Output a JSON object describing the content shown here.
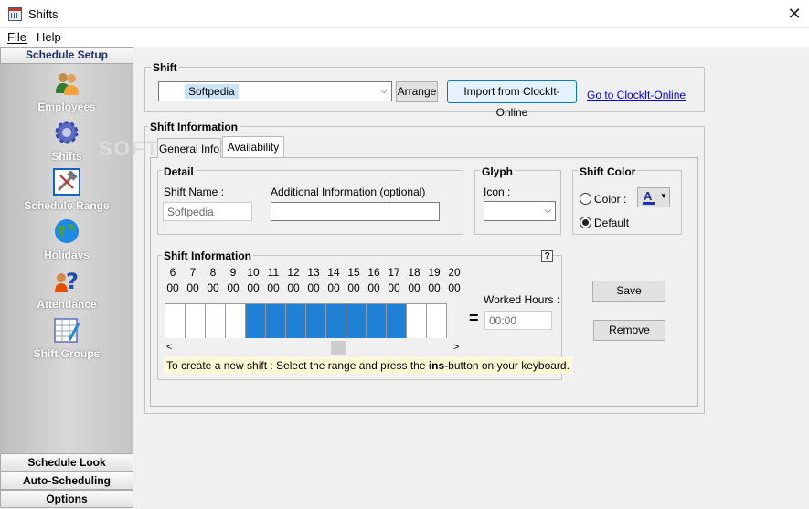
{
  "window": {
    "title": "Shifts"
  },
  "menu": {
    "file": "File",
    "help": "Help"
  },
  "sidebar": {
    "header": "Schedule Setup",
    "items": [
      {
        "label": "Employees",
        "icon": "employees-icon"
      },
      {
        "label": "Shifts",
        "icon": "gear-icon"
      },
      {
        "label": "Schedule Range",
        "icon": "tools-icon"
      },
      {
        "label": "Holidays",
        "icon": "globe-icon"
      },
      {
        "label": "Attendance",
        "icon": "question-icon"
      },
      {
        "label": "Shift Groups",
        "icon": "calculator-icon"
      }
    ],
    "footer": [
      "Schedule Look",
      "Auto-Scheduling",
      "Options"
    ]
  },
  "watermark": "SOFTPEDIA",
  "shift": {
    "group_title": "Shift",
    "selected": "Softpedia",
    "arrange_label": "Arrange",
    "import_label": "Import from ClockIt-Online",
    "goto_link": "Go to ClockIt-Online"
  },
  "info": {
    "group_title": "Shift Information",
    "tabs": [
      "General Info",
      "Availability"
    ],
    "detail": {
      "title": "Detail",
      "shift_name_label": "Shift Name :",
      "shift_name_value": "Softpedia",
      "additional_label": "Additional Information (optional)",
      "additional_value": ""
    },
    "glyph": {
      "title": "Glyph",
      "icon_label": "Icon :"
    },
    "color": {
      "title": "Shift Color",
      "color_label": "Color :",
      "default_label": "Default",
      "selected": "default"
    },
    "timeline": {
      "title": "Shift Information",
      "help": "?",
      "hours": [
        "6",
        "7",
        "8",
        "9",
        "10",
        "11",
        "12",
        "13",
        "14",
        "15",
        "16",
        "17",
        "18",
        "19",
        "20"
      ],
      "minutes": "00",
      "selected_start": "10",
      "selected_end": "18",
      "equals": "=",
      "worked_label": "Worked Hours :",
      "worked_value": "00:00",
      "scroll_left": "<",
      "scroll_right": ">",
      "hint_prefix": "To create a new shift : Select the range and press the ",
      "hint_key": "ins",
      "hint_suffix": "-button on your keyboard."
    },
    "save_label": "Save",
    "remove_label": "Remove"
  },
  "colors": {
    "selection": "#1f82d6",
    "link": "#0000ee",
    "sidebar_title": "#1f2f6f"
  }
}
